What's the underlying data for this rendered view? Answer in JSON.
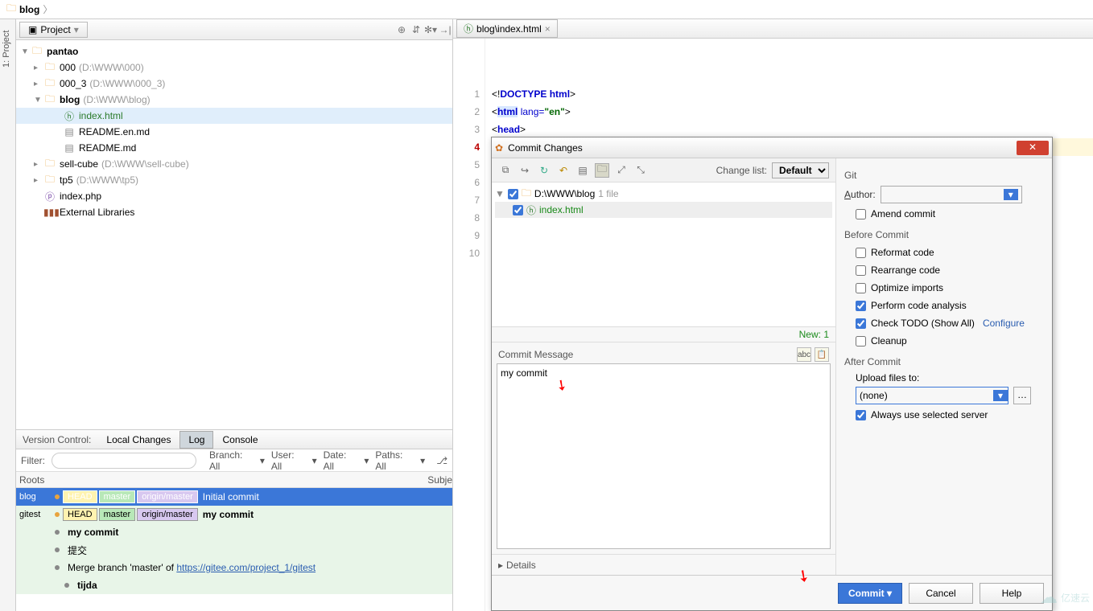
{
  "breadcrumb": {
    "label": "blog"
  },
  "project": {
    "tab_label": "Project",
    "root": "pantao",
    "items": [
      {
        "name": "000",
        "path": "(D:\\WWW\\000)"
      },
      {
        "name": "000_3",
        "path": "(D:\\WWW\\000_3)"
      },
      {
        "name": "blog",
        "path": "(D:\\WWW\\blog)",
        "expanded": true,
        "children": [
          {
            "name": "index.html",
            "selected": true
          },
          {
            "name": "README.en.md"
          },
          {
            "name": "README.md"
          }
        ]
      },
      {
        "name": "sell-cube",
        "path": "(D:\\WWW\\sell-cube)"
      },
      {
        "name": "tp5",
        "path": "(D:\\WWW\\tp5)"
      },
      {
        "name": "index.php",
        "is_file": true
      },
      {
        "name": "External Libraries",
        "is_lib": true
      }
    ]
  },
  "editor": {
    "tab": "blog\\index.html",
    "lines": {
      "1": "<!DOCTYPE html>",
      "2": "<html lang=\"en\">",
      "3": "<head>",
      "4": "",
      "5": "",
      "6": "",
      "7": "",
      "8": "",
      "9": "",
      "10": ""
    },
    "current_line": 4
  },
  "vc": {
    "panel_label": "Version Control:",
    "tabs": [
      "Local Changes",
      "Log",
      "Console"
    ],
    "active_tab": "Log",
    "filter_label": "Filter:",
    "branch_label": "Branch: All",
    "user_label": "User: All",
    "date_label": "Date: All",
    "paths_label": "Paths: All",
    "header_roots": "Roots",
    "header_subject": "Subje",
    "rows": [
      {
        "root": "blog",
        "head": "HEAD",
        "master": "master",
        "origin": "origin/master",
        "msg": "Initial commit",
        "sel": true
      },
      {
        "root": "gitest",
        "head": "HEAD",
        "master": "master",
        "origin": "origin/master",
        "msg": "my commit",
        "bold": true
      },
      {
        "msg": "my commit",
        "bold": true
      },
      {
        "msg": "提交"
      },
      {
        "msg_prefix": "Merge branch 'master' of ",
        "link": "https://gitee.com/project_1/gitest"
      },
      {
        "msg": "tijda",
        "bold": true
      }
    ]
  },
  "dialog": {
    "title": "Commit Changes",
    "change_list_label": "Change list:",
    "change_list_value": "Default",
    "file_root": "D:\\WWW\\blog",
    "file_count": "1 file",
    "file_name": "index.html",
    "new_label": "New: 1",
    "commit_msg_label": "Commit Message",
    "commit_msg_value": "my commit",
    "details_label": "Details",
    "git_label": "Git",
    "author_label": "Author:",
    "amend_label": "Amend commit",
    "before_label": "Before Commit",
    "reformat": "Reformat code",
    "rearrange": "Rearrange code",
    "optimize": "Optimize imports",
    "analysis": "Perform code analysis",
    "todo": "Check TODO (Show All)",
    "configure": "Configure",
    "cleanup": "Cleanup",
    "after_label": "After Commit",
    "upload_label": "Upload files to:",
    "upload_value": "(none)",
    "always_label": "Always use selected server",
    "commit_btn": "Commit",
    "cancel_btn": "Cancel",
    "help_btn": "Help"
  },
  "watermark": "亿速云"
}
